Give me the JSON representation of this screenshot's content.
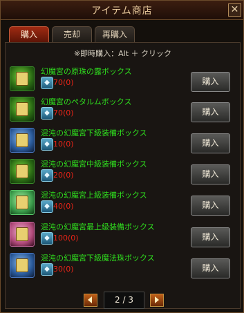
{
  "window": {
    "title": "アイテム商店",
    "close_label": "✕"
  },
  "tabs": [
    {
      "label": "購入",
      "active": true
    },
    {
      "label": "売却",
      "active": false
    },
    {
      "label": "再購入",
      "active": false
    }
  ],
  "hint": "※即時購入：Alt ＋ クリック",
  "currency_icon": "currency-gem-icon",
  "buy_label": "購入",
  "items": [
    {
      "name": "幻魔宮の原珠の露ボックス",
      "price": "70(0)",
      "icon": "potion-box-icon"
    },
    {
      "name": "幻魔宮のペタルムボックス",
      "price": "70(0)",
      "icon": "potion-box-icon"
    },
    {
      "name": "混沌の幻魔宮下級装備ボックス",
      "price": "10(0)",
      "icon": "equipment-box-icon"
    },
    {
      "name": "混沌の幻魔宮中級装備ボックス",
      "price": "20(0)",
      "icon": "equipment-box-icon"
    },
    {
      "name": "混沌の幻魔宮上級装備ボックス",
      "price": "40(0)",
      "icon": "equipment-box-icon"
    },
    {
      "name": "混沌の幻魔宮最上級装備ボックス",
      "price": "100(0)",
      "icon": "equipment-box-icon"
    },
    {
      "name": "混沌の幻魔宮下級魔法珠ボックス",
      "price": "30(0)",
      "icon": "magic-orb-box-icon"
    }
  ],
  "pager": {
    "text": "2 / 3"
  }
}
